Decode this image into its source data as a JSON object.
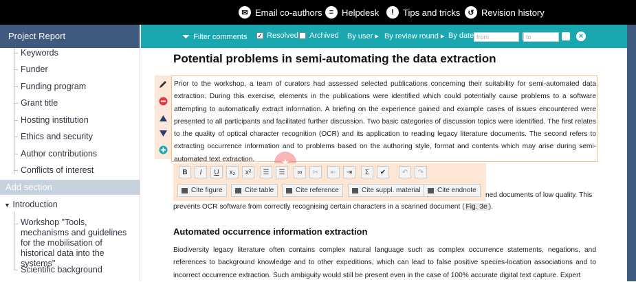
{
  "topbar": {
    "links": [
      {
        "label": "Email co-authors"
      },
      {
        "label": "Helpdesk"
      },
      {
        "label": "Tips and tricks"
      },
      {
        "label": "Revision history"
      }
    ]
  },
  "sidebar": {
    "header": "Project Report",
    "items": [
      {
        "label": "Keywords"
      },
      {
        "label": "Funder"
      },
      {
        "label": "Funding program"
      },
      {
        "label": "Grant title"
      },
      {
        "label": "Hosting institution"
      },
      {
        "label": "Ethics and security"
      },
      {
        "label": "Author contributions"
      },
      {
        "label": "Conflicts of interest"
      }
    ],
    "add_section": "Add section",
    "introduction": "Introduction",
    "sub_items": [
      {
        "label": "Workshop \"Tools, mechanisms and guidelines for the mobilisation of historical data into the systems\""
      },
      {
        "label": "Scientific background"
      }
    ]
  },
  "filterbar": {
    "filter_label": "Filter comments",
    "resolved_label": "Resolved",
    "resolved_checked": true,
    "archived_label": "Archived",
    "archived_checked": false,
    "by_user": "By user ▸",
    "by_round": "By review round ▸",
    "by_date": "By date",
    "from_placeholder": "from",
    "to_placeholder": "to"
  },
  "document": {
    "title": "Potential problems in semi-automating the data extraction",
    "para1": "Prior to the workshop, a team of curators had assessed selected publications concerning their suitability for semi-automated data extraction. During this exercise, elements in the publications were identified which could potentially cause problems to a software attempting to automatically extract information. A briefing on the experience gained and example cases of issues encountered were presented to all participants and facilitated further discussion. Two basic categories of discussion topics were identified. The first relates to the quality of optical character recognition (OCR) and its application to reading legacy literature documents. The second refers to extracting occurrence information and to problems based on the authoring style, format and contents which may arise during semi-automated text extraction.",
    "para2_tail": "ned documents of low quality. This",
    "para2_line2": "prevents OCR software from correctly recognising certain characters in a scanned document (",
    "fig_ref": "Fig. 3e",
    "para2_end": ").",
    "heading2": "Automated occurrence information extraction",
    "para3": "Biodiversity legacy literature often contains complex natural language such as complex occurrence statements, negations, and references to background knowledge and to other expeditions, which can lead to false positive species-location associations and to incorrect occurrence extraction. Such ambiguity would still be present even in the case of 100% accurate digital text capture. Expert"
  },
  "toolbar": {
    "format_buttons": [
      "B",
      "I",
      "U",
      "x₂",
      "x²",
      "☰",
      "☰",
      "∞",
      "✂",
      "⇤",
      "⇥",
      "Σ",
      "✔",
      "↶",
      "↷"
    ],
    "cite_figure": "Cite figure",
    "cite_table": "Cite table",
    "cite_reference": "Cite reference",
    "cite_suppl": "Cite suppl. material",
    "cite_endnote": "Cite endnote"
  },
  "colors": {
    "topbar": "#000000",
    "sidebar_header": "#3f5a7e",
    "filterbar": "#1aa8b0",
    "accent_edit": "#f2c08a"
  }
}
